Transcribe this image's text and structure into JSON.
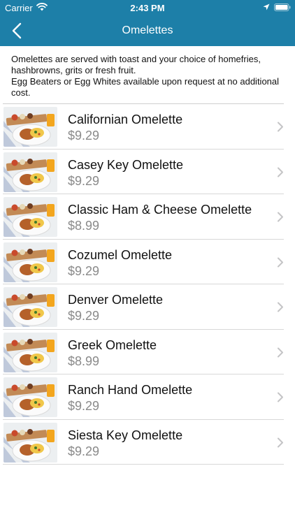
{
  "status_bar": {
    "carrier": "Carrier",
    "time": "2:43 PM",
    "icons": [
      "wifi-icon",
      "location-icon",
      "battery-icon"
    ]
  },
  "nav": {
    "title": "Omelettes",
    "back_icon": "chevron-left-icon"
  },
  "colors": {
    "header": "#1d7fa8",
    "price": "#8a8a8a"
  },
  "intro": {
    "line1": "Omelettes are served with toast and your choice of homefries, hashbrowns, grits or fresh fruit.",
    "line2": "Egg Beaters or Egg Whites available upon request at no additional cost."
  },
  "items": [
    {
      "name": "Californian Omelette",
      "price": "$9.29"
    },
    {
      "name": "Casey Key Omelette",
      "price": "$9.29"
    },
    {
      "name": "Classic Ham & Cheese Omelette",
      "price": "$8.99"
    },
    {
      "name": "Cozumel Omelette",
      "price": "$9.29"
    },
    {
      "name": "Denver Omelette",
      "price": "$9.29"
    },
    {
      "name": "Greek Omelette",
      "price": "$8.99"
    },
    {
      "name": "Ranch Hand Omelette",
      "price": "$9.29"
    },
    {
      "name": "Siesta Key Omelette",
      "price": "$9.29"
    }
  ]
}
